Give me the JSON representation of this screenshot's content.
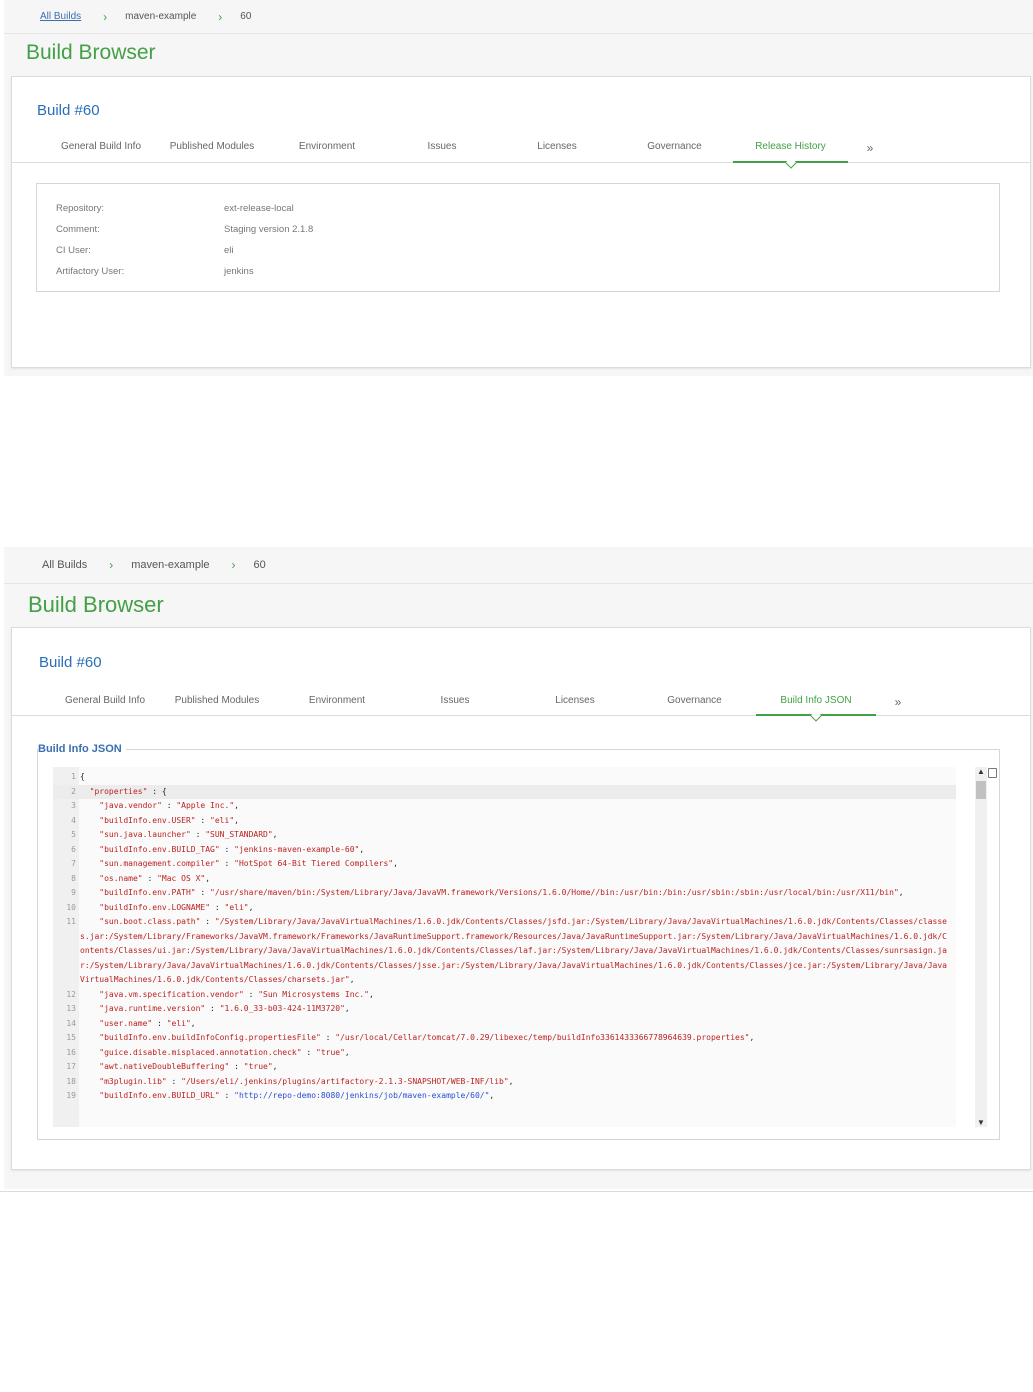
{
  "panel1": {
    "breadcrumbs": [
      "All Builds",
      "maven-example",
      "60"
    ],
    "title": "Build Browser",
    "build_number": "Build #60",
    "tabs": [
      "General Build Info",
      "Published Modules",
      "Environment",
      "Issues",
      "Licenses",
      "Governance",
      "Release History"
    ],
    "active_tab": "Release History",
    "more": "»",
    "info": [
      {
        "label": "Repository:",
        "value": "ext-release-local"
      },
      {
        "label": "Comment:",
        "value": "Staging version 2.1.8"
      },
      {
        "label": "CI User:",
        "value": "eli"
      },
      {
        "label": "Artifactory User:",
        "value": "jenkins"
      }
    ]
  },
  "panel2": {
    "breadcrumbs": [
      "All Builds",
      "maven-example",
      "60"
    ],
    "title": "Build Browser",
    "build_number": "Build #60",
    "tabs": [
      "General Build Info",
      "Published Modules",
      "Environment",
      "Issues",
      "Licenses",
      "Governance",
      "Build Info JSON"
    ],
    "active_tab": "Build Info JSON",
    "more": "»",
    "json_label": "Build Info JSON",
    "code_lines": [
      {
        "n": "1",
        "text": "{"
      },
      {
        "n": "2",
        "text": "  \"properties\" : {"
      },
      {
        "n": "3",
        "text": "    \"java.vendor\" : \"Apple Inc.\","
      },
      {
        "n": "4",
        "text": "    \"buildInfo.env.USER\" : \"eli\","
      },
      {
        "n": "5",
        "text": "    \"sun.java.launcher\" : \"SUN_STANDARD\","
      },
      {
        "n": "6",
        "text": "    \"buildInfo.env.BUILD_TAG\" : \"jenkins-maven-example-60\","
      },
      {
        "n": "7",
        "text": "    \"sun.management.compiler\" : \"HotSpot 64-Bit Tiered Compilers\","
      },
      {
        "n": "8",
        "text": "    \"os.name\" : \"Mac OS X\","
      },
      {
        "n": "9",
        "text": "    \"buildInfo.env.PATH\" : \"/usr/share/maven/bin:/System/Library/Java/JavaVM.framework/Versions/1.6.0/Home//bin:/usr/bin:/bin:/usr/sbin:/sbin:/usr/local/bin:/usr/X11/bin\","
      },
      {
        "n": "10",
        "text": "    \"buildInfo.env.LOGNAME\" : \"eli\","
      },
      {
        "n": "11",
        "text": "    \"sun.boot.class.path\" : \"/System/Library/Java/JavaVirtualMachines/1.6.0.jdk/Contents/Classes/jsfd.jar:/System/Library/Java/JavaVirtualMachines/1.6.0.jdk/Contents/Classes/classes.jar:/System/Library/Frameworks/JavaVM.framework/Frameworks/JavaRuntimeSupport.framework/Resources/Java/JavaRuntimeSupport.jar:/System/Library/Java/JavaVirtualMachines/1.6.0.jdk/Contents/Classes/ui.jar:/System/Library/Java/JavaVirtualMachines/1.6.0.jdk/Contents/Classes/laf.jar:/System/Library/Java/JavaVirtualMachines/1.6.0.jdk/Contents/Classes/sunrsasign.jar:/System/Library/Java/JavaVirtualMachines/1.6.0.jdk/Contents/Classes/jsse.jar:/System/Library/Java/JavaVirtualMachines/1.6.0.jdk/Contents/Classes/jce.jar:/System/Library/Java/JavaVirtualMachines/1.6.0.jdk/Contents/Classes/charsets.jar\","
      },
      {
        "n": "12",
        "text": "    \"java.vm.specification.vendor\" : \"Sun Microsystems Inc.\","
      },
      {
        "n": "13",
        "text": "    \"java.runtime.version\" : \"1.6.0_33-b03-424-11M3720\","
      },
      {
        "n": "14",
        "text": "    \"user.name\" : \"eli\","
      },
      {
        "n": "15",
        "text": "    \"buildInfo.env.buildInfoConfig.propertiesFile\" : \"/usr/local/Cellar/tomcat/7.0.29/libexec/temp/buildInfo3361433366778964639.properties\","
      },
      {
        "n": "16",
        "text": "    \"guice.disable.misplaced.annotation.check\" : \"true\","
      },
      {
        "n": "17",
        "text": "    \"awt.nativeDoubleBuffering\" : \"true\","
      },
      {
        "n": "18",
        "text": "    \"m3plugin.lib\" : \"/Users/eli/.jenkins/plugins/artifactory-2.1.3-SNAPSHOT/WEB-INF/lib\","
      },
      {
        "n": "19",
        "text": "    \"buildInfo.env.BUILD_URL\" : \"http://repo-demo:8080/jenkins/job/maven-example/60/\","
      }
    ]
  },
  "icons": {
    "breadcrumb_separator": "chevron-right-icon",
    "scroll_up": "arrow-up-icon",
    "scroll_down": "arrow-down-icon",
    "copy": "copy-icon"
  },
  "colors": {
    "accent_green": "#43a047",
    "link_blue": "#2a6fb5",
    "json_key_red": "#b22222",
    "json_url_blue": "#2a4fd0"
  }
}
